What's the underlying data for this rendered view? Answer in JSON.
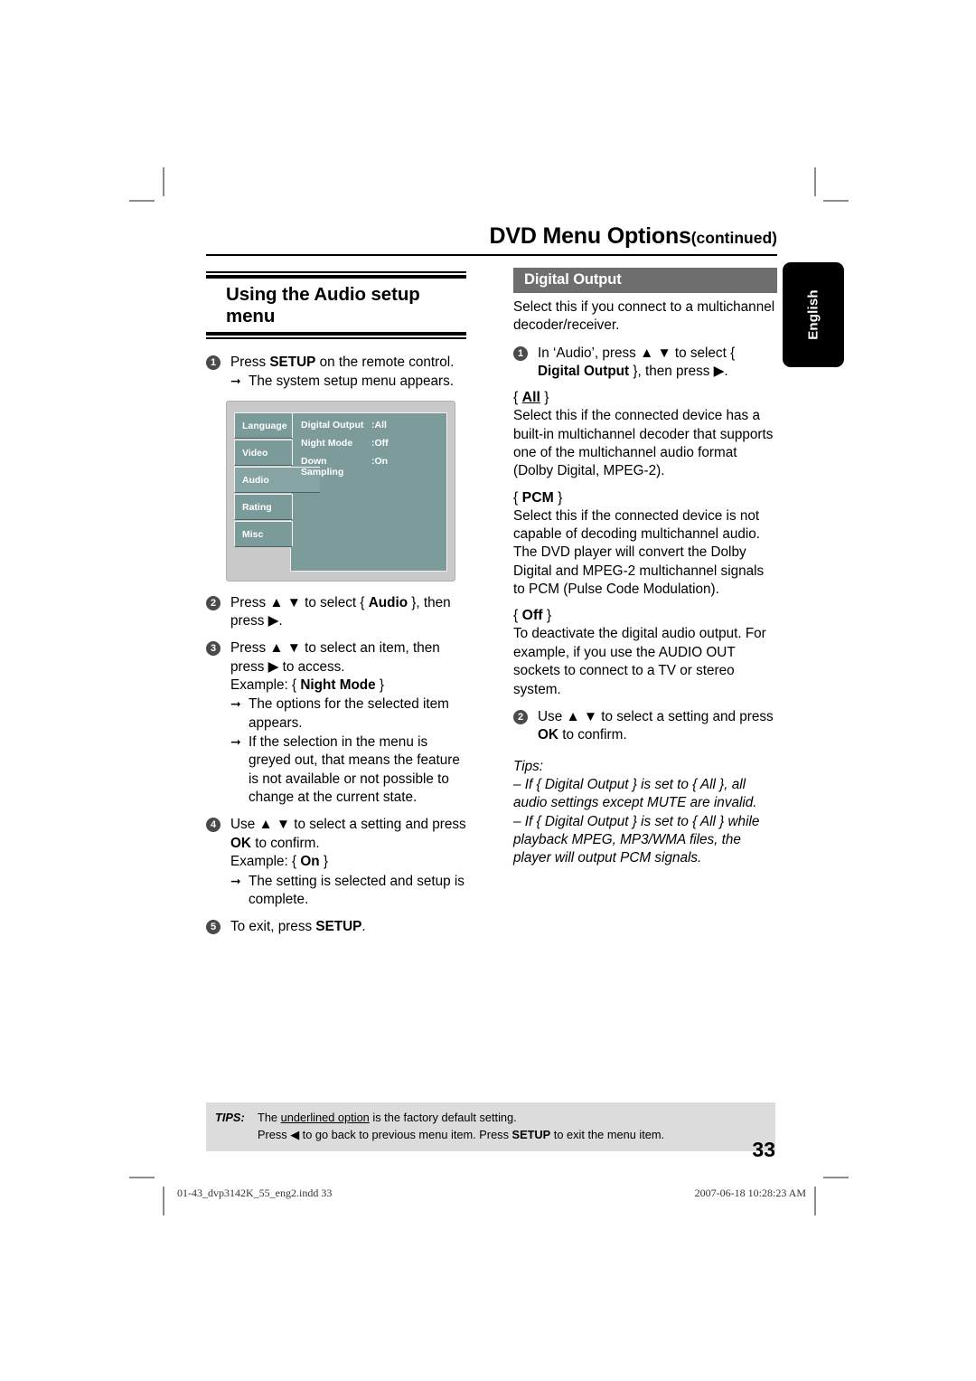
{
  "header": {
    "title": "DVD Menu Options",
    "continued": "(continued)"
  },
  "side_tab": {
    "label": "English"
  },
  "left_column": {
    "section_title": "Using the Audio setup menu",
    "steps": [
      {
        "number": "1",
        "text_parts": {
          "pre": "Press ",
          "key": "SETUP",
          "post": " on the remote control."
        },
        "notes": [
          "The system setup menu appears."
        ]
      },
      {
        "number": "2",
        "text_parts": {
          "pre": "Press ▲ ▼ to select { ",
          "key": "Audio",
          "post": " }, then press ▶."
        },
        "notes": []
      },
      {
        "number": "3",
        "text_parts": {
          "pre": "Press ▲ ▼ to select an item, then press ▶ to access.",
          "key": "",
          "post": ""
        },
        "example_label": "Example: { ",
        "example_value": "Night Mode",
        "example_close": " }",
        "notes": [
          "The options for the selected item appears.",
          "If the selection in the menu is greyed out, that means the feature is not available or not possible to change at the current state."
        ]
      },
      {
        "number": "4",
        "text_parts": {
          "pre": "Use ▲ ▼ to select a setting and press ",
          "key": "OK",
          "post": " to confirm."
        },
        "example_label": "Example: { ",
        "example_value": "On",
        "example_close": " }",
        "notes": [
          "The setting is selected and setup is complete."
        ]
      },
      {
        "number": "5",
        "text_parts": {
          "pre": "To exit, press ",
          "key": "SETUP",
          "post": "."
        },
        "notes": []
      }
    ]
  },
  "setup_menu_mockup": {
    "tabs": [
      {
        "label": "Language",
        "active": false
      },
      {
        "label": "Video",
        "active": false
      },
      {
        "label": "Audio",
        "active": true
      },
      {
        "label": "Rating",
        "active": false
      },
      {
        "label": "Misc",
        "active": false
      }
    ],
    "rows": [
      {
        "label": "Digital Output",
        "value": ":All"
      },
      {
        "label": "Night  Mode",
        "value": ":Off"
      },
      {
        "label": "Down Sampling",
        "value": ":On"
      }
    ],
    "colors": {
      "frame": "#c9c9c9",
      "panel": "#7e9b9b",
      "tab": "#7b9a9a",
      "tab_active": "#87a4a4"
    }
  },
  "right_column": {
    "bar_heading": "Digital Output",
    "intro": "Select this if you connect to a multichannel decoder/receiver.",
    "step1": {
      "number": "1",
      "pre": "In ‘Audio’, press ▲ ▼ to select { ",
      "key": "Digital Output",
      "post": " }, then press ▶."
    },
    "options": [
      {
        "open": "{ ",
        "name": "All",
        "close": " }",
        "underlined": true,
        "body": "Select this if the connected device has a built-in multichannel decoder that supports one of the multichannel audio format (Dolby Digital, MPEG-2)."
      },
      {
        "open": "{ ",
        "name": "PCM",
        "close": " }",
        "underlined": false,
        "body": "Select this if the connected device is not capable of decoding multichannel audio. The DVD player will convert the Dolby Digital and MPEG-2 multichannel signals to PCM (Pulse Code Modulation)."
      },
      {
        "open": "{ ",
        "name": "Off",
        "close": " }",
        "underlined": false,
        "body": "To deactivate the digital audio output. For example, if you use the AUDIO OUT sockets to connect to a TV or stereo system."
      }
    ],
    "step2": {
      "number": "2",
      "pre": "Use ▲ ▼ to select a setting and press ",
      "key": "OK",
      "post": " to confirm."
    },
    "tips_label": "Tips:",
    "tips": [
      "– If { Digital Output } is set to { All }, all audio settings except MUTE are invalid.",
      "– If { Digital Output } is set to { All } while playback MPEG, MP3/WMA files, the player will output PCM signals."
    ]
  },
  "footer_tips": {
    "label": "TIPS:",
    "line1_pre": "The ",
    "line1_underlined": "underlined option",
    "line1_post": " is the factory default setting.",
    "line2_pre": "Press ◀ to go back to previous menu item. Press ",
    "line2_key": "SETUP",
    "line2_post": " to exit the menu item."
  },
  "page_number": "33",
  "print_footer": {
    "left": "01-43_dvp3142K_55_eng2.indd   33",
    "right": "2007-06-18   10:28:23 AM"
  }
}
